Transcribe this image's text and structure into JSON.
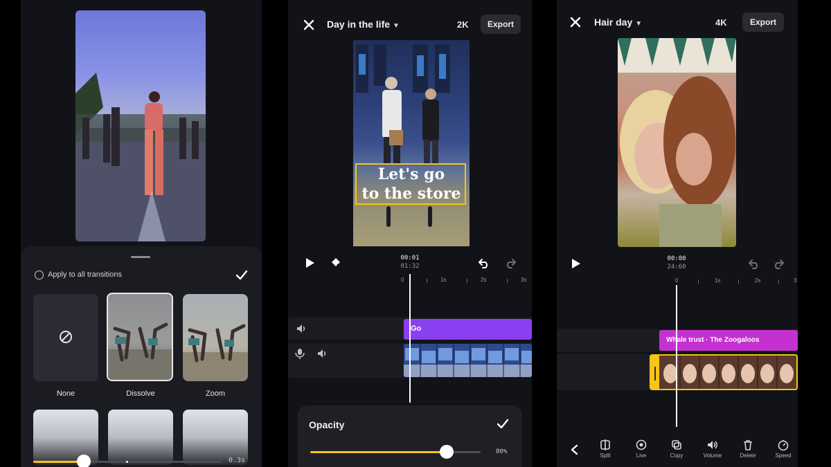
{
  "phone1": {
    "apply_all_label": "Apply to all transitions",
    "transitions": [
      {
        "label": "None",
        "selected": false
      },
      {
        "label": "Dissolve",
        "selected": true
      },
      {
        "label": "Zoom",
        "selected": false
      }
    ],
    "duration_label": "0.3s",
    "duration_fraction": 0.27,
    "accent": "#f5c518"
  },
  "phone2": {
    "title": "Day in the life",
    "resolution": "2K",
    "export_label": "Export",
    "caption_line1": "Let's go",
    "caption_line2": "to the store",
    "time_current": "00:01",
    "time_total": "01:32",
    "ruler": [
      "0",
      "1s",
      "2s",
      "3s"
    ],
    "text_clip": "Go",
    "opacity_title": "Opacity",
    "opacity_value": "80%",
    "opacity_fraction": 0.8,
    "clip_color": "#8a3ff0"
  },
  "phone3": {
    "title": "Hair day",
    "resolution": "4K",
    "export_label": "Export",
    "time_current": "00:00",
    "time_total": "24:60",
    "ruler": [
      "0",
      "1s",
      "2s",
      "3"
    ],
    "music_clip": "Whale trust · The Zoogaloos",
    "tools": [
      "Split",
      "Live",
      "Copy",
      "Volume",
      "Delete",
      "Speed"
    ],
    "clip_color": "#c531d0"
  }
}
